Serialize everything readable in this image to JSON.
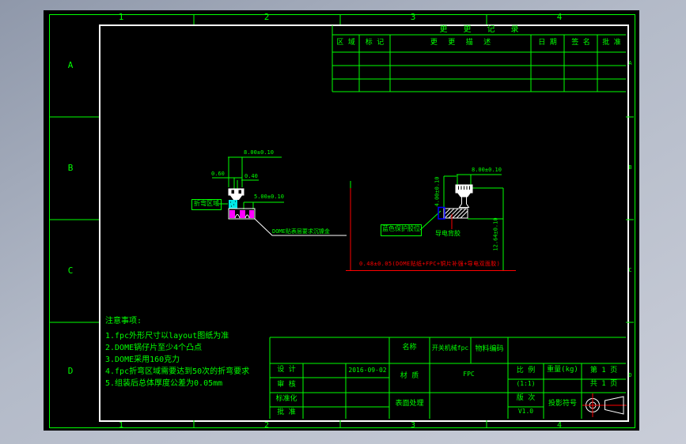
{
  "colors": {
    "line_green": "#00ff00",
    "annotation_red": "#ff0000",
    "detail_white": "#ffffff",
    "bend_cyan": "#00e8e8",
    "hatch_magenta": "#ff00ff",
    "liner_blue": "#0000ff",
    "sheet_black": "#000000"
  },
  "border": {
    "zone_rows": [
      "A",
      "B",
      "C",
      "D"
    ],
    "zone_cols": [
      "1",
      "2",
      "3",
      "4"
    ]
  },
  "change_table": {
    "title": "更 更 记 录",
    "headers": [
      "区 域",
      "标 记",
      "更 更 描 述",
      "日 期",
      "签 名",
      "批 准"
    ]
  },
  "left_view": {
    "dim_width_top": "8.00±0.10",
    "dim_offset": "0.60",
    "dim_stem": "0.40",
    "dim_width_bottom": "5.00±0.10",
    "bend_area_label": "折弯区域",
    "surface_note": "DOME贴表层要求沉镍金"
  },
  "right_view": {
    "dim_width_top": "8.00±0.10",
    "dim_height_left": "4.00±0.10",
    "dim_height_right": "12.64±0.10",
    "protect_glue_label": "蓝色保护胶位",
    "conductive_adhesive_label": "导电背胶",
    "stack_thickness_note": "0.48±0.05(DOME贴纸+FPC+铜片补强+导电双面胶)"
  },
  "notes": {
    "title": "注意事项:",
    "items": [
      "1.fpc外形尺寸以layout图纸为准",
      "2.DOME锅仔片至少4个凸点",
      "3.DOME采用160克力",
      "4.fpc折弯区域需要达到50次的折弯要求",
      "5.组装后总体厚度公差为0.05mm"
    ]
  },
  "title_block": {
    "design_label": "设 计",
    "design_date": "2016-09-02",
    "review_label": "审 核",
    "standardize_label": "标准化",
    "approve_label": "批 准",
    "name_label": "名称",
    "name_value": "开关机械fpc",
    "material_label": "材 质",
    "material_value": "FPC",
    "surface_label": "表面处理",
    "part_code_label": "物料编码",
    "scale_label": "比 例",
    "scale_value": "(1:1)",
    "weight_label": "重量(kg)",
    "page_label": "第 1 页",
    "total_pages_label": "共 1 页",
    "revision_label": "版 次",
    "revision_value": "V1.0",
    "projection_label": "投影符号"
  }
}
